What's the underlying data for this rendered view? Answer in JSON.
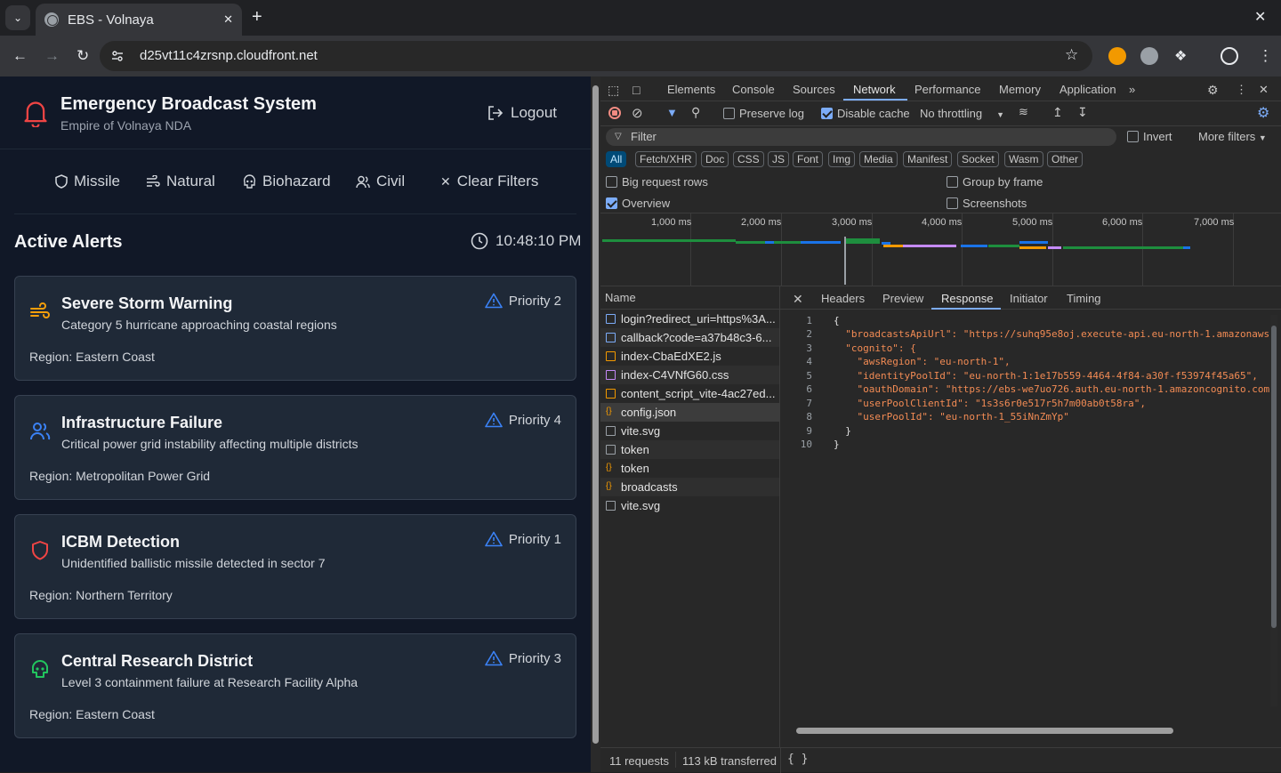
{
  "browser": {
    "tab_title": "EBS - Volnaya",
    "url": "d25vt11c4zrsnp.cloudfront.net"
  },
  "app": {
    "title": "Emergency Broadcast System",
    "subtitle": "Empire of Volnaya NDA",
    "logout_label": "Logout",
    "filters": {
      "missile": "Missile",
      "natural": "Natural",
      "biohazard": "Biohazard",
      "civil": "Civil",
      "clear": "Clear Filters"
    },
    "section_title": "Active Alerts",
    "time": "10:48:10 PM",
    "alerts": [
      {
        "title": "Severe Storm Warning",
        "description": "Category 5 hurricane approaching coastal regions",
        "region": "Region: Eastern Coast",
        "priority": "Priority 2",
        "icon": "wind-icon",
        "color": "#f59e0b"
      },
      {
        "title": "Infrastructure Failure",
        "description": "Critical power grid instability affecting multiple districts",
        "region": "Region: Metropolitan Power Grid",
        "priority": "Priority 4",
        "icon": "users-icon",
        "color": "#3b82f6"
      },
      {
        "title": "ICBM Detection",
        "description": "Unidentified ballistic missile detected in sector 7",
        "region": "Region: Northern Territory",
        "priority": "Priority 1",
        "icon": "shield-icon",
        "color": "#ef4444"
      },
      {
        "title": "Central Research District",
        "description": "Level 3 containment failure at Research Facility Alpha",
        "region": "Region: Eastern Coast",
        "priority": "Priority 3",
        "icon": "biohazard-icon",
        "color": "#22c55e"
      }
    ]
  },
  "devtools": {
    "tabs": [
      "Elements",
      "Console",
      "Sources",
      "Network",
      "Performance",
      "Memory",
      "Application"
    ],
    "active_tab": "Network",
    "preserve_log": "Preserve log",
    "disable_cache": "Disable cache",
    "throttling": "No throttling",
    "filter_placeholder": "Filter",
    "invert": "Invert",
    "more_filters": "More filters",
    "types": [
      "All",
      "Fetch/XHR",
      "Doc",
      "CSS",
      "JS",
      "Font",
      "Img",
      "Media",
      "Manifest",
      "Socket",
      "Wasm",
      "Other"
    ],
    "options": {
      "big_rows": "Big request rows",
      "group_by_frame": "Group by frame",
      "overview": "Overview",
      "screenshots": "Screenshots"
    },
    "timeline_ticks": [
      "1,000 ms",
      "2,000 ms",
      "3,000 ms",
      "4,000 ms",
      "5,000 ms",
      "6,000 ms",
      "7,000 ms"
    ],
    "name_header": "Name",
    "requests": [
      {
        "name": "login?redirect_uri=https%3A...",
        "type": "doc"
      },
      {
        "name": "callback?code=a37b48c3-6...",
        "type": "doc"
      },
      {
        "name": "index-CbaEdXE2.js",
        "type": "js"
      },
      {
        "name": "index-C4VNfG60.css",
        "type": "css"
      },
      {
        "name": "content_script_vite-4ac27ed...",
        "type": "js"
      },
      {
        "name": "config.json",
        "type": "json"
      },
      {
        "name": "vite.svg",
        "type": "other"
      },
      {
        "name": "token",
        "type": "other"
      },
      {
        "name": "token",
        "type": "json"
      },
      {
        "name": "broadcasts",
        "type": "json"
      },
      {
        "name": "vite.svg",
        "type": "other"
      }
    ],
    "detail_tabs": [
      "Headers",
      "Preview",
      "Response",
      "Initiator",
      "Timing"
    ],
    "active_detail_tab": "Response",
    "response_lines": [
      "{",
      "  \"broadcastsApiUrl\": \"https://suhq95e8oj.execute-api.eu-north-1.amazonaws",
      "  \"cognito\": {",
      "    \"awsRegion\": \"eu-north-1\",",
      "    \"identityPoolId\": \"eu-north-1:1e17b559-4464-4f84-a30f-f53974f45a65\",",
      "    \"oauthDomain\": \"https://ebs-we7uo726.auth.eu-north-1.amazoncognito.com",
      "    \"userPoolClientId\": \"1s3s6r0e517r5h7m00ab0t58ra\",",
      "    \"userPoolId\": \"eu-north-1_55iNnZmYp\"",
      "  }",
      "}"
    ],
    "requests_count": "11 requests",
    "transferred": "113 kB transferred"
  }
}
